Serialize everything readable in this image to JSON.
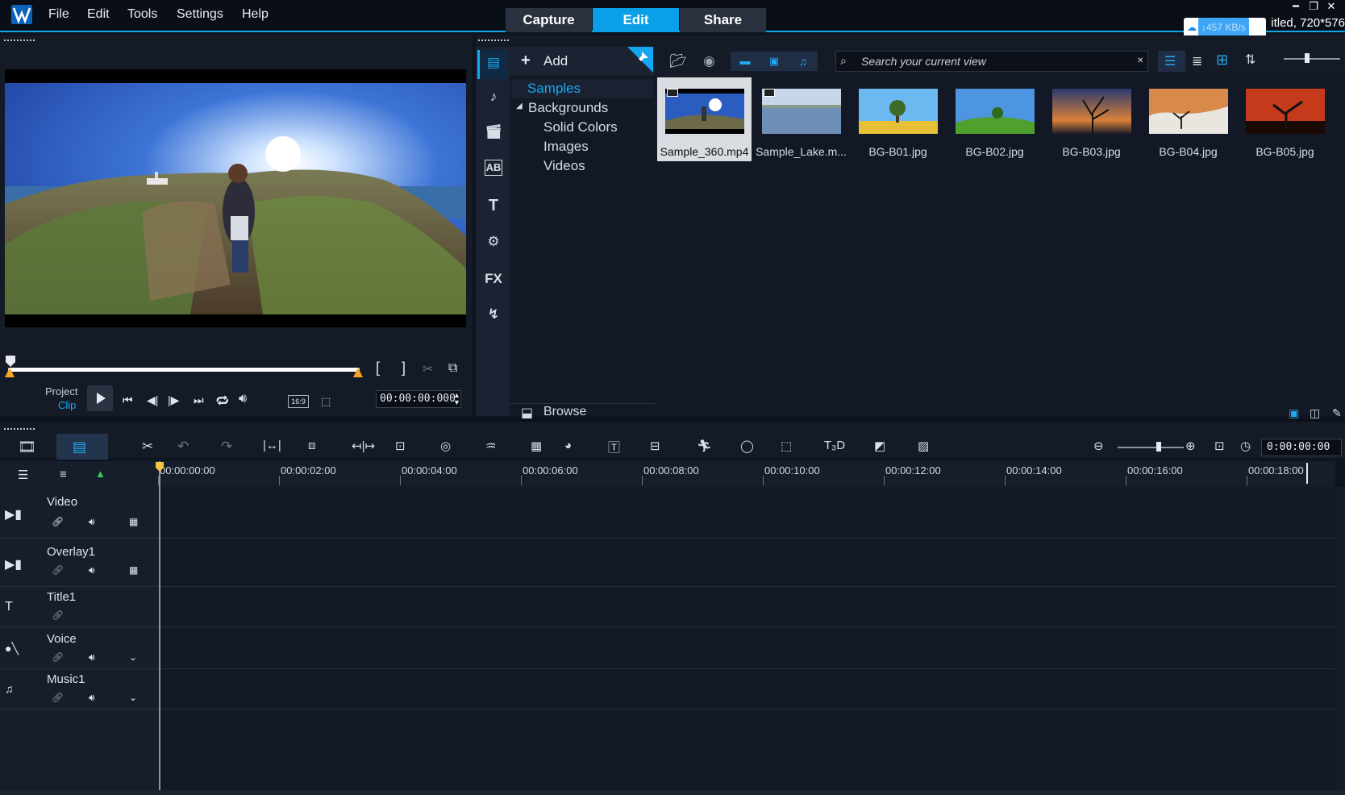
{
  "menu": {
    "file": "File",
    "edit": "Edit",
    "tools": "Tools",
    "settings": "Settings",
    "help": "Help"
  },
  "modes": [
    "Capture",
    "Edit",
    "Share"
  ],
  "active_mode": "Edit",
  "project_info": "itled, 720*576",
  "net_speed": "457 KB/s",
  "preview": {
    "project_label": "Project",
    "clip_label": "Clip",
    "timecode": "00:00:00:000",
    "aspect_ratio": "16:9"
  },
  "library": {
    "add_label": "Add",
    "search_placeholder": "Search your current view",
    "browse_label": "Browse",
    "tree": {
      "samples": "Samples",
      "backgrounds": "Backgrounds",
      "solid_colors": "Solid Colors",
      "images": "Images",
      "videos": "Videos"
    },
    "thumbnails": [
      {
        "caption": "Sample_360.mp4",
        "selected": true,
        "type": "video"
      },
      {
        "caption": "Sample_Lake.m...",
        "selected": false,
        "type": "video"
      },
      {
        "caption": "BG-B01.jpg",
        "selected": false,
        "type": "image"
      },
      {
        "caption": "BG-B02.jpg",
        "selected": false,
        "type": "image"
      },
      {
        "caption": "BG-B03.jpg",
        "selected": false,
        "type": "image"
      },
      {
        "caption": "BG-B04.jpg",
        "selected": false,
        "type": "image"
      },
      {
        "caption": "BG-B05.jpg",
        "selected": false,
        "type": "image"
      }
    ],
    "side_fx_label": "FX"
  },
  "timeline": {
    "timecode": "0:00:00:00",
    "ruler_ticks": [
      "00:00:00:00",
      "00:00:02:00",
      "00:00:04:00",
      "00:00:06:00",
      "00:00:08:00",
      "00:00:10:00",
      "00:00:12:00",
      "00:00:14:00",
      "00:00:16:00",
      "00:00:18:00"
    ],
    "tracks": [
      {
        "name": "Video"
      },
      {
        "name": "Overlay1"
      },
      {
        "name": "Title1"
      },
      {
        "name": "Voice"
      },
      {
        "name": "Music1"
      }
    ]
  },
  "colors": {
    "accent": "#11a7e8",
    "panel": "#141b27",
    "selected_thumb": "#d9dde2"
  }
}
